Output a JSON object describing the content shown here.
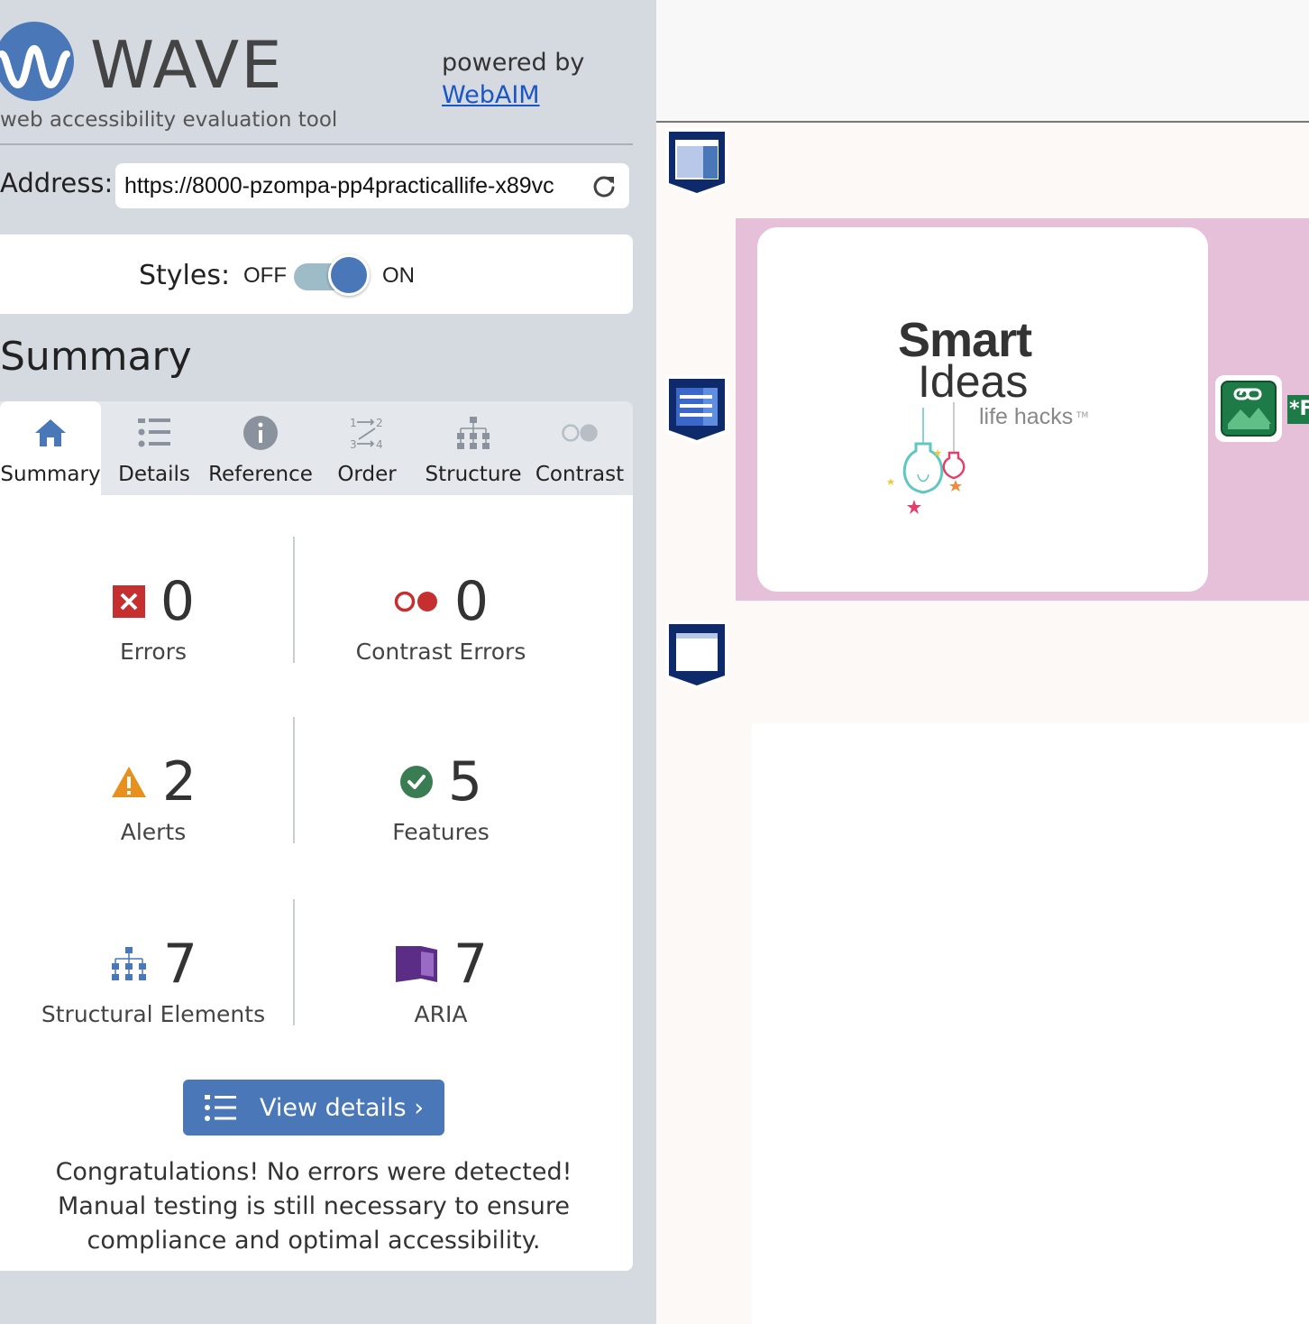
{
  "header": {
    "logo_text": "WAVE",
    "tagline": "web accessibility evaluation tool",
    "powered_by": "powered by",
    "webaim_link": "WebAIM"
  },
  "address": {
    "label": "Address:",
    "value": "https://8000-pzompa-pp4practicallife-x89vc"
  },
  "styles": {
    "label": "Styles:",
    "off_label": "OFF",
    "on_label": "ON",
    "state": "on"
  },
  "summary": {
    "heading": "Summary",
    "tabs": [
      {
        "label": "Summary",
        "icon": "home-icon",
        "active": true
      },
      {
        "label": "Details",
        "icon": "list-icon",
        "active": false
      },
      {
        "label": "Reference",
        "icon": "info-icon",
        "active": false
      },
      {
        "label": "Order",
        "icon": "order-icon",
        "active": false
      },
      {
        "label": "Structure",
        "icon": "structure-icon",
        "active": false
      },
      {
        "label": "Contrast",
        "icon": "contrast-icon",
        "active": false
      }
    ],
    "stats": {
      "errors": {
        "count": "0",
        "label": "Errors",
        "icon": "error-icon",
        "color": "#c62f30"
      },
      "contrast_errors": {
        "count": "0",
        "label": "Contrast Errors",
        "icon": "contrast-error-icon",
        "color": "#c62f30"
      },
      "alerts": {
        "count": "2",
        "label": "Alerts",
        "icon": "alert-icon",
        "color": "#e8901e"
      },
      "features": {
        "count": "5",
        "label": "Features",
        "icon": "feature-check-icon",
        "color": "#3a7d52"
      },
      "structural": {
        "count": "7",
        "label": "Structural Elements",
        "icon": "structure-icon",
        "color": "#4a77b8"
      },
      "aria": {
        "count": "7",
        "label": "ARIA",
        "icon": "aria-icon",
        "color": "#5b2d86"
      }
    },
    "view_details_label": "View details ›",
    "congrats": "Congratulations! No errors were detected! Manual testing is still necessary to ensure compliance and optimal accessibility."
  },
  "preview": {
    "logo_smart": "Smart",
    "logo_ideas": "Ideas",
    "logo_lifehacks": "life hacks",
    "logo_tm": "TM",
    "flag_text": "*F"
  },
  "colors": {
    "sidebar_bg": "#d5dae1",
    "accent": "#4a77b8",
    "link": "#1a56c4",
    "preview_pink": "#e6bfd9",
    "badge_navy": "#0e2a6b"
  }
}
